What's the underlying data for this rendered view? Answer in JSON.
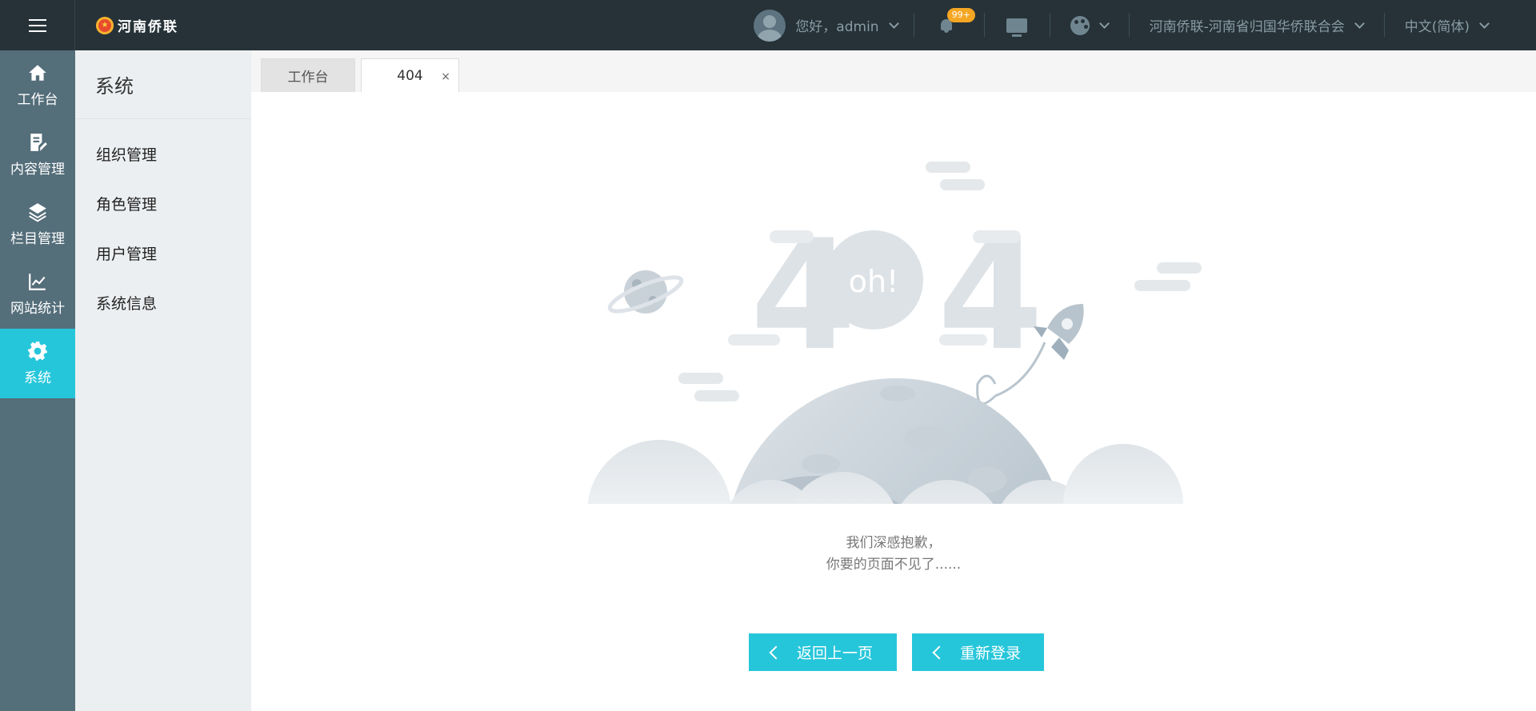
{
  "header": {
    "logo_text": "河南侨联",
    "greeting": "您好，admin",
    "notification_badge": "99+",
    "organization": "河南侨联-河南省归国华侨联合会",
    "language": "中文(简体)"
  },
  "nav": {
    "items": [
      {
        "label": "工作台",
        "icon": "home-icon"
      },
      {
        "label": "内容管理",
        "icon": "document-edit-icon"
      },
      {
        "label": "栏目管理",
        "icon": "layers-icon"
      },
      {
        "label": "网站统计",
        "icon": "line-chart-icon"
      },
      {
        "label": "系统",
        "icon": "gear-icon",
        "active": true
      }
    ]
  },
  "subnav": {
    "title": "系统",
    "items": [
      "组织管理",
      "角色管理",
      "用户管理",
      "系统信息"
    ]
  },
  "tabs": [
    {
      "label": "工作台"
    },
    {
      "label": "404",
      "active": true,
      "close": "×"
    }
  ],
  "error": {
    "code_left": "4",
    "code_right": "4",
    "bubble": "oh!",
    "line1": "我们深感抱歉，",
    "line2": "你要的页面不见了......"
  },
  "buttons": {
    "back": "返回上一页",
    "relogin": "重新登录"
  },
  "colors": {
    "topbar": "#263238",
    "sidebar": "#546e7a",
    "accent": "#26c6da",
    "badge": "#f5a623"
  }
}
